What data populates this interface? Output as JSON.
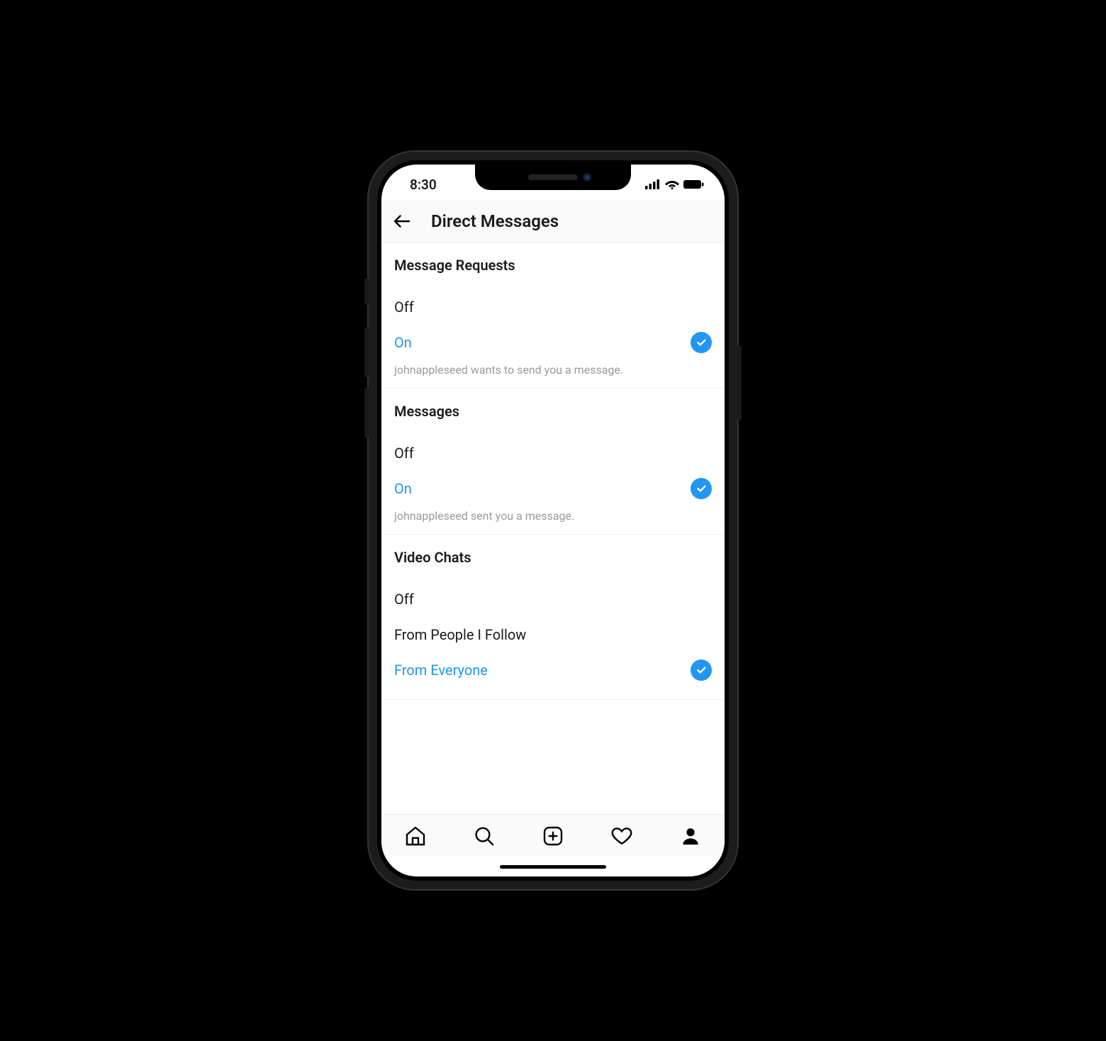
{
  "statusBar": {
    "time": "8:30"
  },
  "header": {
    "title": "Direct Messages"
  },
  "sections": {
    "messageRequests": {
      "title": "Message Requests",
      "options": {
        "off": "Off",
        "on": "On"
      },
      "desc": "johnappleseed wants to send you a message."
    },
    "messages": {
      "title": "Messages",
      "options": {
        "off": "Off",
        "on": "On"
      },
      "desc": "johnappleseed sent you a message."
    },
    "videoChats": {
      "title": "Video Chats",
      "options": {
        "off": "Off",
        "fromFollow": "From People I Follow",
        "fromEveryone": "From Everyone"
      }
    }
  }
}
